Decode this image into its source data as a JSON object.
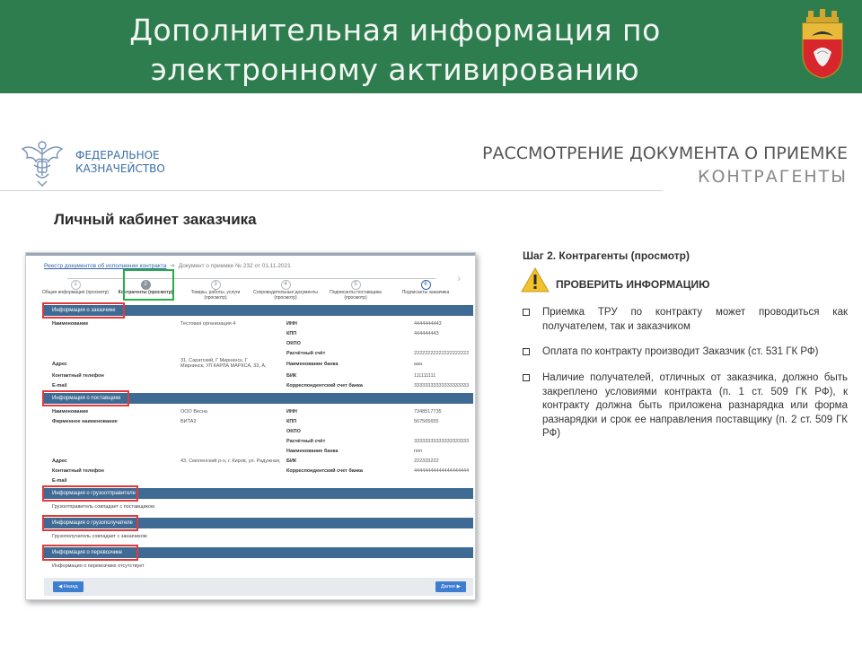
{
  "slide": {
    "title_line1": "Дополнительная информация по",
    "title_line2": "электронному активированию",
    "brand_line1": "ФЕДЕРАЛЬНОЕ",
    "brand_line2": "КАЗНАЧЕЙСТВО",
    "doc_heading_line1": "РАССМОТРЕНИЕ ДОКУМЕНТА О ПРИЕМКЕ",
    "doc_heading_line2": "КОНТРАГЕНТЫ",
    "cabinet_title": "Личный кабинет заказчика",
    "colors": {
      "banner": "#2e7d4f",
      "section": "#3f6a94",
      "highlight_green": "#27ae48",
      "highlight_red": "#e23a3a"
    }
  },
  "screenshot": {
    "breadcrumb_link": "Реестр документов об исполнении контракта",
    "breadcrumb_current": "Документ о приемке № 232 от 01.11.2021",
    "steps": [
      {
        "num": "1",
        "label": "Общая информация (просмотр)"
      },
      {
        "num": "2",
        "label": "Контрагенты (просмотр)"
      },
      {
        "num": "3",
        "label": "Товары, работы, услуги (просмотр)"
      },
      {
        "num": "4",
        "label": "Сопроводительные документы (просмотр)"
      },
      {
        "num": "5",
        "label": "Подписанты поставщика (просмотр)"
      },
      {
        "num": "6",
        "label": "Подписанты заказчика"
      }
    ],
    "sections": {
      "customer": "Информация о заказчике",
      "supplier": "Информация о поставщике",
      "shipper": "Информация о грузоотправителе",
      "consignee": "Информация о грузополучателе",
      "carrier": "Информация о перевозчике"
    },
    "customer": {
      "name_label": "Наименование",
      "name_value": "Тестовая организация 4",
      "address_label": "Адрес",
      "address_value": "31, Саратский, Г Мирнинск, Г Мирнинск, УЛ КАРЛА МАРКСА, 33, А,",
      "phone_label": "Контактный телефон",
      "email_label": "E-mail",
      "inn_label": "ИНН",
      "inn_value": "4444444443",
      "kpp_label": "КПП",
      "kpp_value": "444444443",
      "okpo_label": "ОКПО",
      "account_label": "Расчётный счёт",
      "account_value": "22222222222222222222",
      "bank_label": "Наименование банка",
      "bank_value": "ааа",
      "bik_label": "БИК",
      "bik_value": "111111111",
      "corr_label": "Корреспондентский счет банка",
      "corr_value": "33333333333333333333"
    },
    "supplier": {
      "name_label": "Наименование",
      "name_value": "ООО Весна",
      "brand_label": "Фирменное наименование",
      "brand_value": "ВИТА2",
      "address_label": "Адрес",
      "address_value": "43, Смоленский р-н, г. Киров, ул. Радужная,",
      "phone_label": "Контактный телефон",
      "email_label": "E-mail",
      "inn_label": "ИНН",
      "inn_value": "7348517735",
      "kpp_label": "КПП",
      "kpp_value": "567565655",
      "okpo_label": "ОКПО",
      "account_label": "Расчётный счёт",
      "account_value": "33333333333333333333",
      "bank_label": "Наименование банка",
      "bank_value": "ппп",
      "bik_label": "БИК",
      "bik_value": "222333222",
      "corr_label": "Корреспондентский счет банка",
      "corr_value": "44444444444444444444"
    },
    "shipper_text": "Грузоотправитель совпадает с поставщиком",
    "consignee_text": "Грузополучатель совпадает с заказчиком",
    "carrier_text": "Информация о перевозчике отсутствует",
    "back_button": "Назад",
    "next_button": "Далее"
  },
  "notes": {
    "step_title": "Шаг 2. Контрагенты (просмотр)",
    "check_title": "ПРОВЕРИТЬ ИНФОРМАЦИЮ",
    "bullets": [
      "Приемка ТРУ по контракту может проводиться как получателем, так и заказчиком",
      "Оплата по контракту производит Заказчик (ст. 531 ГК РФ)",
      "Наличие получателей, отличных от заказчика, должно быть закреплено условиями контракта (п. 1 ст. 509 ГК РФ), к контракту должна быть приложена разнарядка или форма разнарядки и срок ее направления поставщику (п. 2 ст. 509 ГК РФ)"
    ]
  }
}
